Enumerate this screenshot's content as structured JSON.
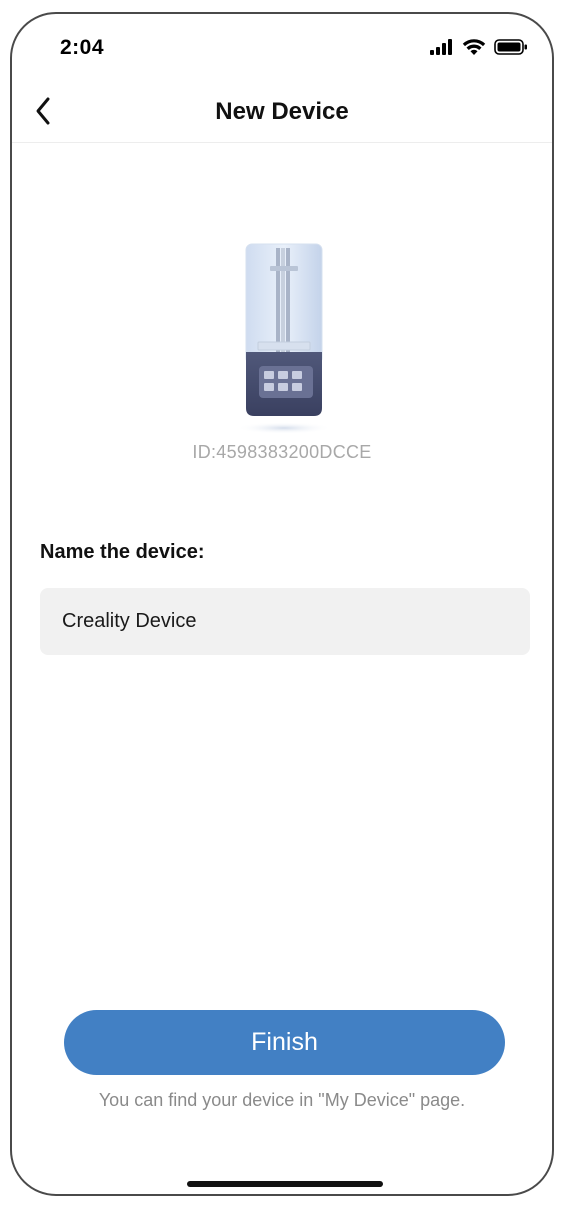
{
  "status_bar": {
    "time": "2:04",
    "icons": [
      "cellular-signal-icon",
      "wifi-icon",
      "battery-icon"
    ]
  },
  "navbar": {
    "back_icon": "chevron-left-icon",
    "title": "New Device"
  },
  "device": {
    "image": "resin-printer-image",
    "id_text": "ID:4598383200DCCE"
  },
  "form": {
    "name_label": "Name the device:",
    "name_value": "Creality Device"
  },
  "footer": {
    "finish_label": "Finish",
    "hint": "You can find your device in \"My Device\" page."
  },
  "colors": {
    "accent": "#4280c4",
    "input_bg": "#f1f1f1",
    "muted_text": "#a8a8a8"
  }
}
